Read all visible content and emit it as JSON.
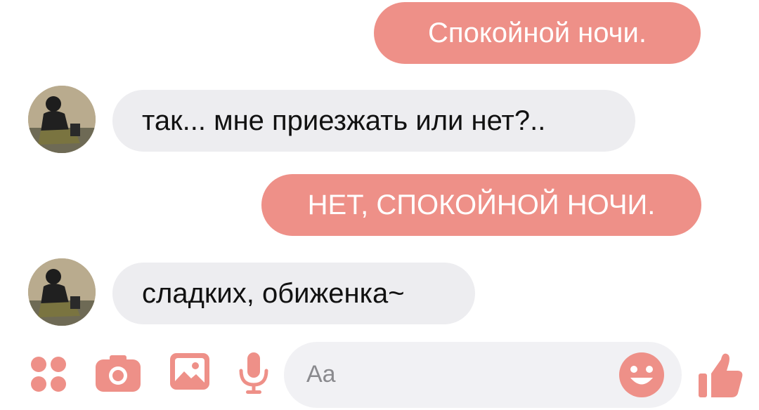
{
  "messages": [
    {
      "direction": "outgoing",
      "text": "Спокойной ночи."
    },
    {
      "direction": "incoming",
      "text": "так... мне приезжать или нет?.."
    },
    {
      "direction": "outgoing",
      "text": "НЕТ, СПОКОЙНОЙ НОЧИ."
    },
    {
      "direction": "incoming",
      "text": "сладких, обиженка~"
    }
  ],
  "composer": {
    "placeholder": "Aa"
  },
  "icons": {
    "menu": "four-dots-icon",
    "camera": "camera-icon",
    "gallery": "image-icon",
    "voice": "microphone-icon",
    "emoji": "smiley-icon",
    "like": "thumbs-up-icon"
  },
  "colors": {
    "accent": "#ee9088",
    "incoming_bubble": "#ededf0",
    "composer_background": "#f1f1f4"
  }
}
